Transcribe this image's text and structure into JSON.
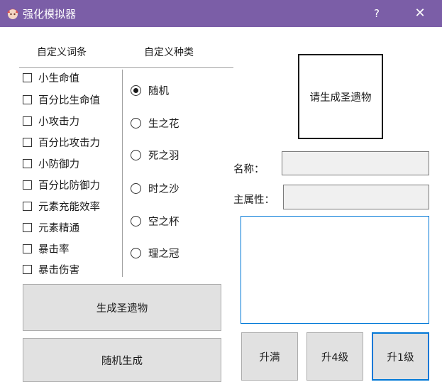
{
  "window": {
    "title": "强化模拟器",
    "help": "?",
    "close": "✕"
  },
  "headers": {
    "affixes": "自定义词条",
    "types": "自定义种类"
  },
  "affixes": [
    "小生命值",
    "百分比生命值",
    "小攻击力",
    "百分比攻击力",
    "小防御力",
    "百分比防御力",
    "元素充能效率",
    "元素精通",
    "暴击率",
    "暴击伤害"
  ],
  "types": [
    {
      "label": "随机",
      "checked": true
    },
    {
      "label": "生之花",
      "checked": false
    },
    {
      "label": "死之羽",
      "checked": false
    },
    {
      "label": "时之沙",
      "checked": false
    },
    {
      "label": "空之杯",
      "checked": false
    },
    {
      "label": "理之冠",
      "checked": false
    }
  ],
  "buttons": {
    "generate": "生成圣遗物",
    "random": "随机生成",
    "max": "升满",
    "up4": "升4级",
    "up1": "升1级"
  },
  "preview": {
    "placeholder": "请生成圣遗物"
  },
  "fields": {
    "name_label": "名称：",
    "main_label": "主属性："
  }
}
